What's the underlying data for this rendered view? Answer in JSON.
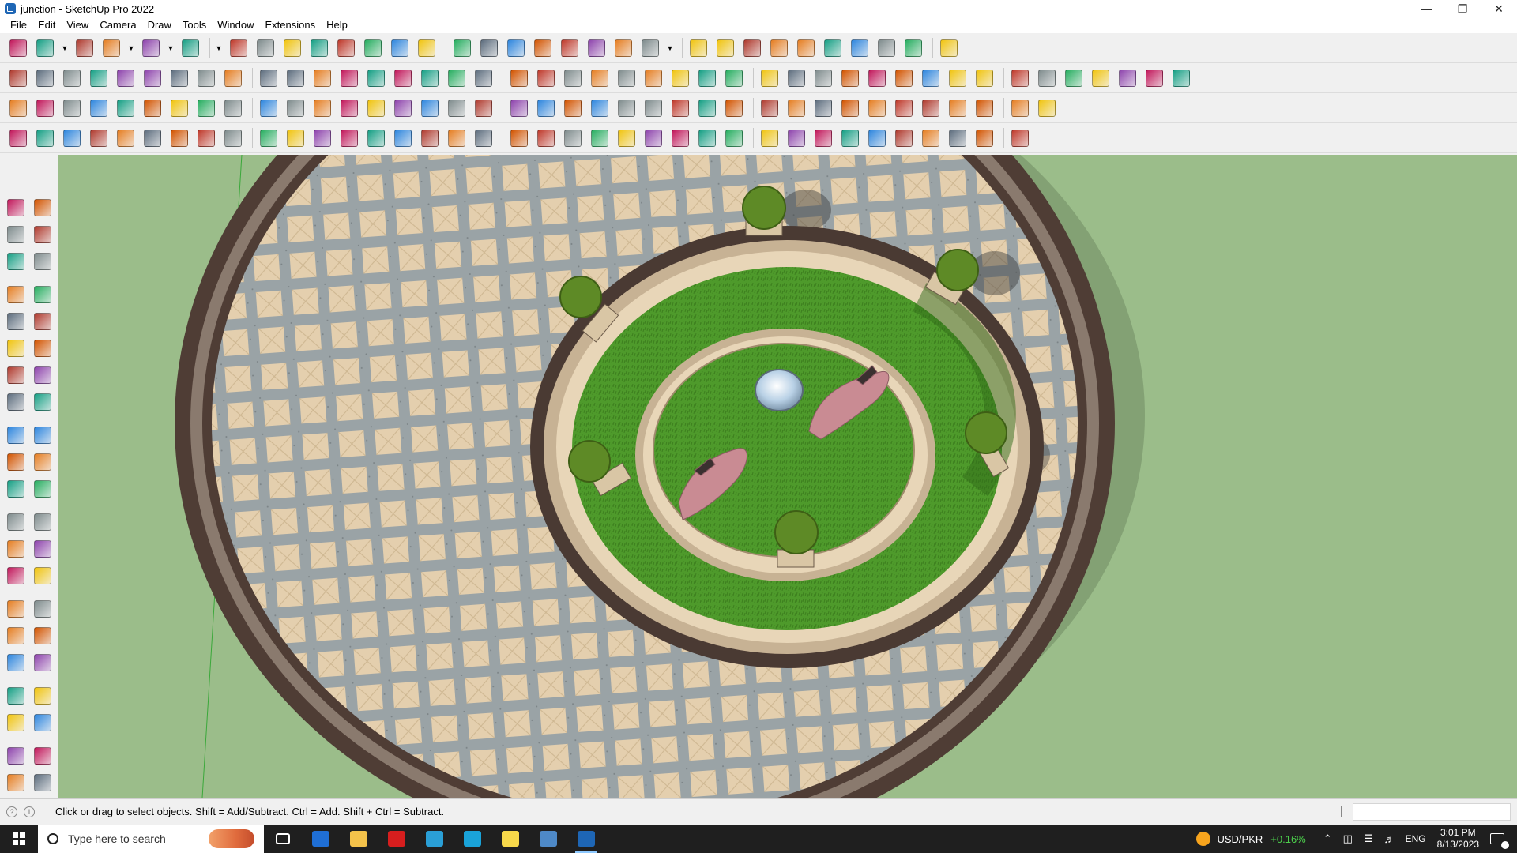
{
  "window": {
    "title": "junction - SketchUp Pro 2022",
    "controls": [
      "minimize",
      "restore",
      "close"
    ]
  },
  "menu": [
    "File",
    "Edit",
    "View",
    "Camera",
    "Draw",
    "Tools",
    "Window",
    "Extensions",
    "Help"
  ],
  "toolbars": {
    "row1": [
      "search-icon",
      "select-icon",
      "dropdown-icon",
      "eraser-icon",
      "pencil-icon",
      "dropdown-icon",
      "lasso-icon",
      "dropdown-icon",
      "paint-icon",
      "dropdown-icon",
      "push-pull-icon",
      "follow-me-icon",
      "move-icon",
      "rotate-icon",
      "scale-icon",
      "tape-measure-icon",
      "text-icon",
      "orbit-icon",
      "pan-icon",
      "zoom-icon",
      "zoom-extents-icon",
      "warehouse-icon",
      "extension-icon",
      "layers-icon",
      "components-icon",
      "profile-icon",
      "dropdown-icon",
      "section-icon",
      "section-fill-icon",
      "axes-icon",
      "sort-icon",
      "sort-desc-icon",
      "tools-icon",
      "share-icon",
      "undo-icon",
      "redo-icon",
      "stop-icon"
    ],
    "row2": [
      "box-icon",
      "box-shaded-icon",
      "box-textured-icon",
      "push-icon",
      "extrude-icon",
      "extrude-blue-icon",
      "extrude-red-icon",
      "extrude-green-icon",
      "extrude-orange-icon",
      "extrude-purple-icon",
      "sandbox-icon",
      "panel-icon",
      "panel2-icon",
      "panel3-icon",
      "roof-icon",
      "wall-icon",
      "house-icon",
      "house2-icon",
      "house3-icon",
      "house4-icon",
      "house5-icon",
      "formula-icon",
      "leaf-icon",
      "knife-icon",
      "rect-icon",
      "circle-icon",
      "polygon-icon",
      "ellipse-icon",
      "parallelogram-icon",
      "arc-icon",
      "spiral-icon",
      "helix-icon",
      "star-icon",
      "curve-icon",
      "offset-icon",
      "eraser-pink-icon",
      "layer-a-icon",
      "layer-b-icon",
      "solid-a-icon",
      "solid-b-icon",
      "solid-c-icon",
      "solid-d-icon",
      "solid-e-icon"
    ],
    "row3": [
      "plane-blue-icon",
      "plane-blue2-icon",
      "plane-yellow-icon",
      "plane-green-icon",
      "plane-red-icon",
      "plane-outline-icon",
      "arc-orange-icon",
      "rect-red-icon",
      "stairs-icon",
      "frame-icon",
      "beam-icon",
      "chain-icon",
      "fillet-icon",
      "curve-red-icon",
      "cross-red-icon",
      "cross-green-icon",
      "cross-blue-icon",
      "cone-icon",
      "cone2-icon",
      "pyramid-icon",
      "hook-icon",
      "hook2-icon",
      "loop-icon",
      "star-blue-icon",
      "box-red-icon",
      "magnet-icon",
      "grid-green-icon",
      "cube-a-icon",
      "cube-b-icon",
      "cube-c-icon",
      "flower-icon",
      "grid-blue-icon",
      "grid-orange-icon",
      "grid-orange2-icon",
      "grid-orange3-icon",
      "scatter-icon",
      "curve-dots-icon",
      "grid-dots-icon"
    ],
    "row4": [
      "draw-a-icon",
      "draw-b-icon",
      "draw-c-icon",
      "draw-d-icon",
      "draw-e-icon",
      "draw-f-icon",
      "draw-g-icon",
      "draw-h-icon",
      "draw-i-icon",
      "draw-j-icon",
      "draw-k-icon",
      "draw-l-icon",
      "draw-m-icon",
      "draw-n-icon",
      "draw-o-icon",
      "draw-p-icon",
      "draw-q-icon",
      "draw-r-icon",
      "draw-s-icon",
      "draw-t-icon",
      "draw-u-icon",
      "draw-v-icon",
      "draw-w-icon",
      "draw-x-icon",
      "draw-y-icon",
      "draw-z-icon",
      "draw-aa-icon",
      "draw-ab-icon",
      "draw-ac-icon",
      "draw-ad-icon",
      "draw-ae-icon",
      "draw-af-icon",
      "draw-ag-icon",
      "draw-ah-icon",
      "draw-ai-icon",
      "draw-aj-icon",
      "draw-ak-icon"
    ]
  },
  "lefttools": [
    [
      "select-icon",
      "orbit-icon"
    ],
    [
      "paint-bucket-icon",
      "eraser-icon"
    ],
    [
      "component-icon",
      "tag-icon"
    ],
    [
      "line-icon",
      "freehand-icon"
    ],
    [
      "rectangle-icon",
      "rotated-rect-icon"
    ],
    [
      "circle-icon",
      "polygon-icon"
    ],
    [
      "arc-icon",
      "arc2-icon"
    ],
    [
      "pie-icon",
      "arc3-icon"
    ],
    [
      "move-icon",
      "push-pull-icon"
    ],
    [
      "rotate-icon",
      "follow-me-icon"
    ],
    [
      "scale-icon",
      "offset-icon"
    ],
    [
      "tape-icon",
      "dimension-icon"
    ],
    [
      "protractor-icon",
      "text-icon"
    ],
    [
      "axes-icon",
      "3d-text-icon"
    ],
    [
      "orbit2-icon",
      "pan-icon"
    ],
    [
      "zoom-icon",
      "zoom-window-icon"
    ],
    [
      "zoom-extents-icon",
      "previous-icon"
    ],
    [
      "position-camera-icon",
      "look-around-icon"
    ],
    [
      "walk-icon",
      "section-plane-icon"
    ],
    [
      "warehouse-icon",
      "extension-icon"
    ],
    [
      "layers-icon",
      "styles-icon"
    ]
  ],
  "status": {
    "text": "Click or drag to select objects. Shift = Add/Subtract. Ctrl = Add. Shift + Ctrl = Subtract.",
    "vcb_value": ""
  },
  "taskbar": {
    "search_placeholder": "Type here to search",
    "apps": [
      "task-view-icon",
      "calculator-icon",
      "file-explorer-icon",
      "acrobat-icon",
      "sketchup-3-icon",
      "edge-icon",
      "sticky-notes-icon",
      "layout-icon",
      "sketchup-icon"
    ],
    "currency_pair": "USD/PKR",
    "currency_change": "+0.16%",
    "language": "ENG",
    "time": "3:01 PM",
    "date": "8/13/2023"
  },
  "colors": {
    "sky_ground": "#9bbd8a",
    "paving_tile": "#e4cfae",
    "paving_joint": "#9aa3a6",
    "border_dark": "#4f3d35",
    "grass": "#4e9a2b",
    "cream_ring": "#e8d6b8",
    "statue_pink": "#c98b93",
    "accent_blue": "#1e66b5",
    "taskbar": "#1f1f1f"
  }
}
